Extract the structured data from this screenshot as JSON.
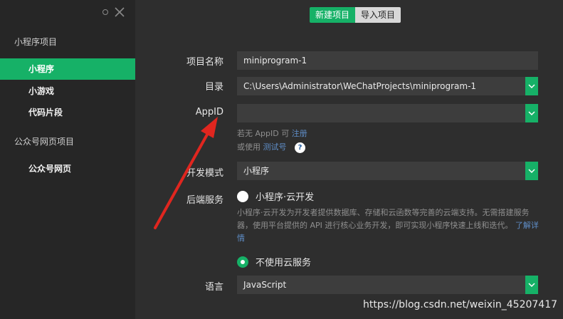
{
  "sidebar": {
    "section_mini": "小程序项目",
    "items_mini": [
      {
        "label": "小程序",
        "active": true
      },
      {
        "label": "小游戏",
        "active": false
      },
      {
        "label": "代码片段",
        "active": false
      }
    ],
    "section_web": "公众号网页项目",
    "items_web": [
      {
        "label": "公众号网页",
        "active": false
      }
    ]
  },
  "tabs": {
    "new_project": "新建项目",
    "import_project": "导入项目"
  },
  "form": {
    "project_name_label": "项目名称",
    "project_name_value": "miniprogram-1",
    "directory_label": "目录",
    "directory_value": "C:\\Users\\Administrator\\WeChatProjects\\miniprogram-1",
    "appid_label": "AppID",
    "appid_value": "",
    "appid_hint_prefix": "若无 AppID 可",
    "appid_hint_link": "注册",
    "appid_test_prefix": "或使用",
    "appid_test_link": "测试号",
    "help_glyph": "?",
    "dev_mode_label": "开发模式",
    "dev_mode_value": "小程序",
    "backend_label": "后端服务",
    "cloud_option": "小程序·云开发",
    "cloud_desc": "小程序·云开发为开发者提供数据库、存储和云函数等完善的云端支持。无需搭建服务器，使用平台提供的 API 进行核心业务开发，即可实现小程序快速上线和迭代。",
    "cloud_more_link": "了解详情",
    "no_cloud_option": "不使用云服务",
    "language_label": "语言",
    "language_value": "JavaScript"
  },
  "watermark": "https://blog.csdn.net/weixin_45207417",
  "colors": {
    "accent": "#16b167",
    "sidebar_bg": "#262626",
    "main_bg": "#2e2e2e",
    "field_bg": "#3d3d3d",
    "annotation_arrow": "#e0261f"
  }
}
